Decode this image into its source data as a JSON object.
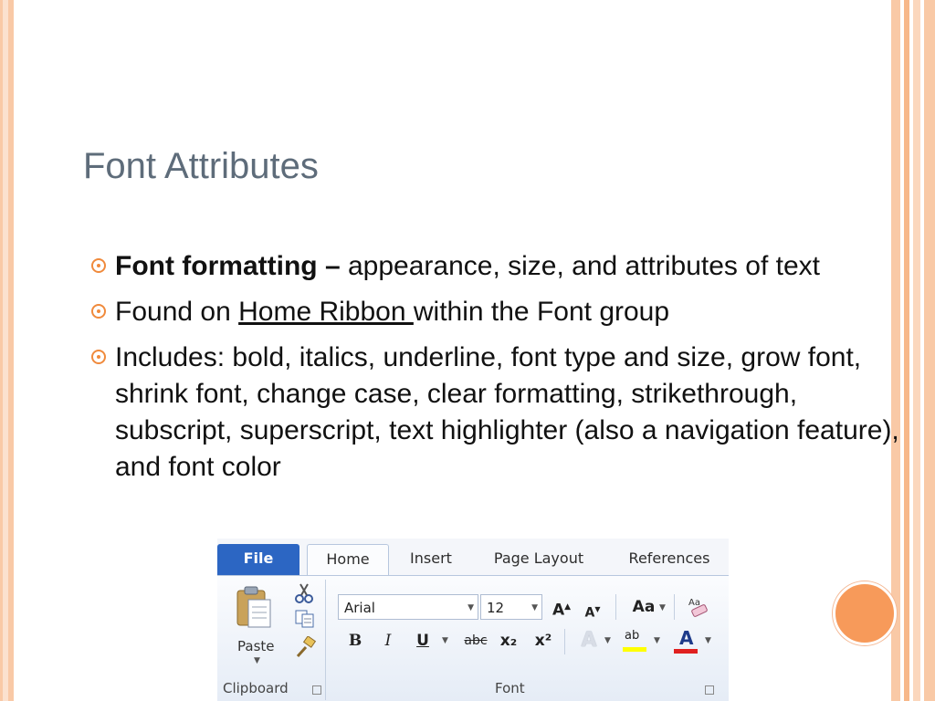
{
  "slide": {
    "title": "Font Attributes",
    "bullets": [
      {
        "bold": "Font formatting –",
        "text": " appearance, size, and attributes of text"
      },
      {
        "pre": "Found on ",
        "underlined": "Home Ribbon ",
        "post": "within the Font group"
      },
      {
        "text": "Includes: bold, italics, underline, font type and size, grow font, shrink font, change case, clear formatting, strikethrough, subscript, superscript, text highlighter (also a navigation feature), and font color"
      }
    ]
  },
  "ribbon": {
    "tabs": {
      "file": "File",
      "home": "Home",
      "insert": "Insert",
      "page_layout": "Page Layout",
      "references": "References"
    },
    "clipboard": {
      "paste": "Paste",
      "group_label": "Clipboard"
    },
    "font": {
      "font_name": "Arial",
      "font_size": "12",
      "group_label": "Font",
      "change_case": "Aa",
      "bold": "B",
      "italic": "I",
      "underline": "U",
      "strikethrough": "abc",
      "subscript": "x₂",
      "superscript": "x²",
      "highlight": "ab",
      "font_color": "A"
    }
  },
  "colors": {
    "bullet_accent": "#f08a3c",
    "file_tab": "#2c66c3",
    "highlight_yellow": "#ffff00",
    "font_color_red": "#e02020"
  }
}
